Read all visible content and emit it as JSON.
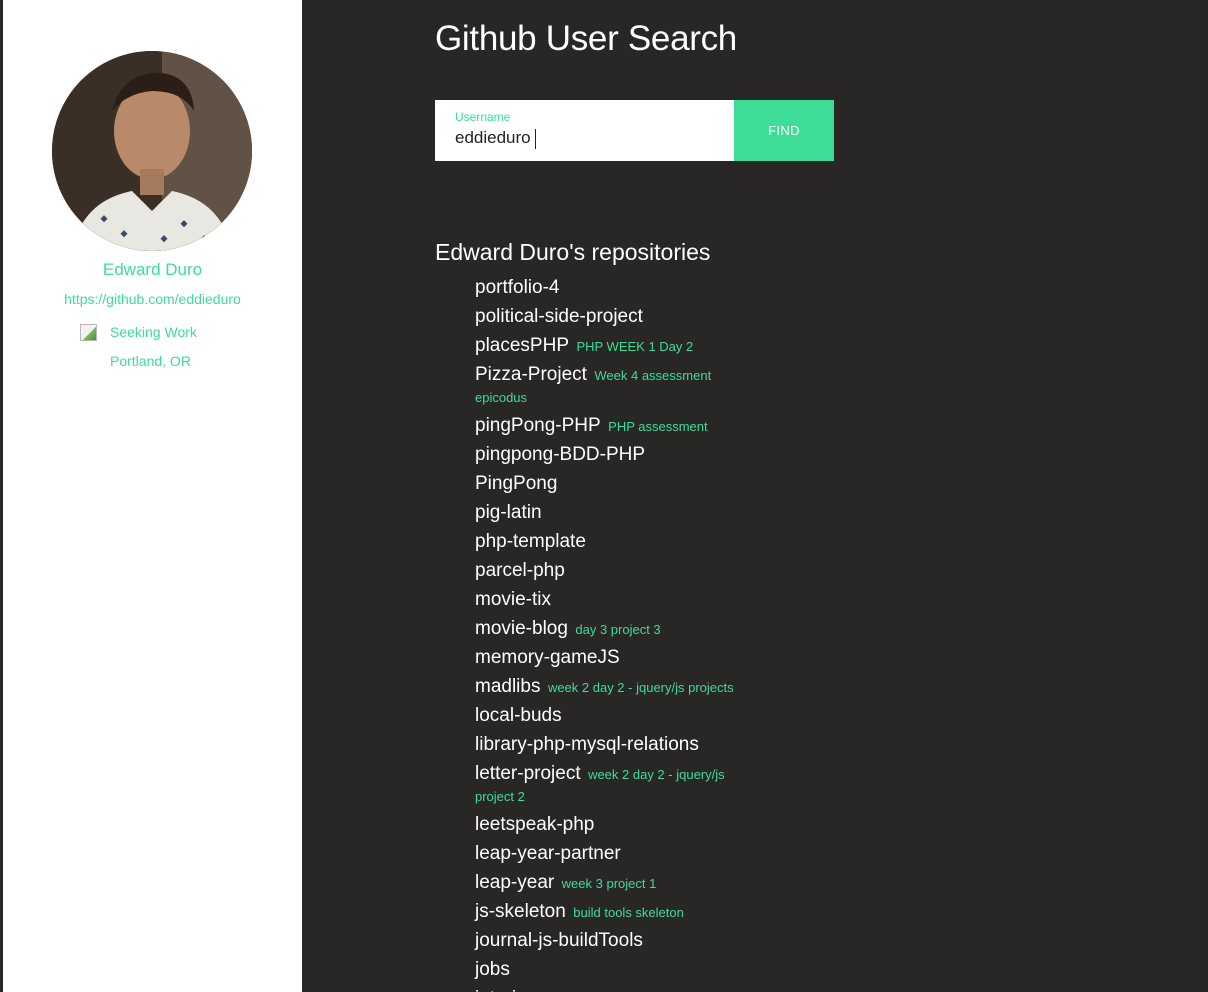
{
  "colors": {
    "accent": "#3ddc97",
    "background": "#282726",
    "sidebar": "#ffffff",
    "text": "#ffffff"
  },
  "profile": {
    "avatar_icon": "user-photo",
    "name": "Edward Duro",
    "url": "https://github.com/eddieduro",
    "hireable_label": "Seeking Work",
    "hireable_icon": "broken-image-icon",
    "location": "Portland, OR"
  },
  "header": {
    "title": "Github User Search"
  },
  "search": {
    "label": "Username",
    "value": "eddieduro",
    "button_label": "FIND"
  },
  "repos": {
    "heading": "Edward Duro's repositories",
    "items": [
      {
        "name": "portfolio-4",
        "description": ""
      },
      {
        "name": "political-side-project",
        "description": ""
      },
      {
        "name": "placesPHP",
        "description": "PHP WEEK 1 Day 2"
      },
      {
        "name": "Pizza-Project",
        "description": "Week 4 assessment epicodus"
      },
      {
        "name": "pingPong-PHP",
        "description": "PHP assessment"
      },
      {
        "name": "pingpong-BDD-PHP",
        "description": ""
      },
      {
        "name": "PingPong",
        "description": ""
      },
      {
        "name": "pig-latin",
        "description": ""
      },
      {
        "name": "php-template",
        "description": ""
      },
      {
        "name": "parcel-php",
        "description": ""
      },
      {
        "name": "movie-tix",
        "description": ""
      },
      {
        "name": "movie-blog",
        "description": "day 3 project 3"
      },
      {
        "name": "memory-gameJS",
        "description": ""
      },
      {
        "name": "madlibs",
        "description": "week 2 day 2 - jquery/js projects"
      },
      {
        "name": "local-buds",
        "description": ""
      },
      {
        "name": "library-php-mysql-relations",
        "description": ""
      },
      {
        "name": "letter-project",
        "description": "week 2 day 2 - jquery/js project 2"
      },
      {
        "name": "leetspeak-php",
        "description": ""
      },
      {
        "name": "leap-year-partner",
        "description": ""
      },
      {
        "name": "leap-year",
        "description": "week 3 project 1"
      },
      {
        "name": "js-skeleton",
        "description": "build tools skeleton"
      },
      {
        "name": "journal-js-buildTools",
        "description": ""
      },
      {
        "name": "jobs",
        "description": ""
      },
      {
        "name": "interior",
        "description": ""
      }
    ]
  }
}
